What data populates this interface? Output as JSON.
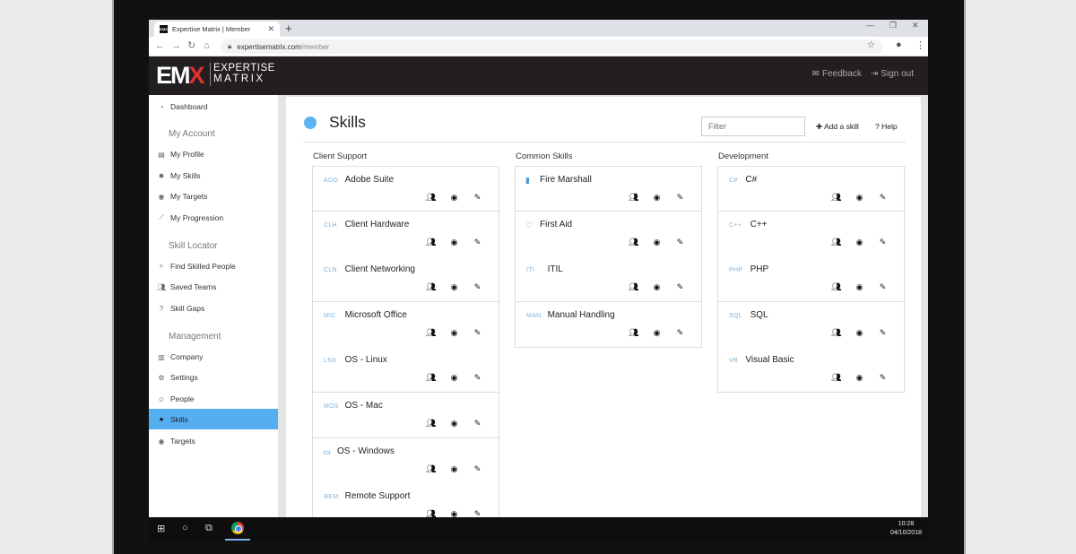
{
  "browser": {
    "tab_title": "Expertise Matrix | Member",
    "tab_favicon": "EMX",
    "new_tab": "+",
    "url_host": "expertisematrix.com",
    "url_path": "/member"
  },
  "header": {
    "logo_mark_a": "EM",
    "logo_mark_b": "X",
    "logo_line1": "EXPERTISE",
    "logo_line2": "MATRIX",
    "feedback": "Feedback",
    "signout": "Sign out"
  },
  "sidebar": {
    "dashboard": "Dashboard",
    "my_account_heading": "My Account",
    "my_profile": "My Profile",
    "my_skills": "My Skills",
    "my_targets": "My Targets",
    "my_progression": "My Progression",
    "skill_locator_heading": "Skill Locator",
    "find_skilled": "Find Skilled People",
    "saved_teams": "Saved Teams",
    "skill_gaps": "Skill Gaps",
    "management_heading": "Management",
    "company": "Company",
    "settings": "Settings",
    "people": "People",
    "skills": "Skills",
    "targets": "Targets"
  },
  "page": {
    "title": "Skills",
    "filter_placeholder": "Filter",
    "add_skill": "Add a skill",
    "help": "Help"
  },
  "columns": [
    {
      "heading": "Client Support",
      "skills": [
        {
          "abbr": "ADO",
          "name": "Adobe Suite"
        },
        {
          "abbr": "CLH",
          "name": "Client Hardware"
        },
        {
          "abbr": "CLN",
          "name": "Client Networking"
        },
        {
          "abbr": "MIC",
          "name": "Microsoft Office"
        },
        {
          "abbr": "LNX",
          "name": "OS - Linux"
        },
        {
          "abbr": "MOS",
          "name": "OS - Mac"
        },
        {
          "abbr": "",
          "name": "OS - Windows",
          "icon": "window-icon"
        },
        {
          "abbr": "REM",
          "name": "Remote Support"
        }
      ]
    },
    {
      "heading": "Common Skills",
      "skills": [
        {
          "abbr": "",
          "name": "Fire Marshall",
          "icon": "extinguisher-icon"
        },
        {
          "abbr": "",
          "name": "First Aid",
          "icon": "heartbeat-icon"
        },
        {
          "abbr": "ITI",
          "name": "ITIL"
        },
        {
          "abbr": "MAN",
          "name": "Manual Handling"
        }
      ]
    },
    {
      "heading": "Development",
      "skills": [
        {
          "abbr": "C#",
          "name": "C#"
        },
        {
          "abbr": "C++",
          "name": "C++"
        },
        {
          "abbr": "PHP",
          "name": "PHP"
        },
        {
          "abbr": "SQL",
          "name": "SQL"
        },
        {
          "abbr": "VB",
          "name": "Visual Basic"
        }
      ]
    }
  ],
  "taskbar": {
    "time": "10:28",
    "date": "04/10/2018"
  },
  "colors": {
    "accent": "#55aef0",
    "header_bg": "#231f20",
    "logo_red": "#e0312e"
  }
}
